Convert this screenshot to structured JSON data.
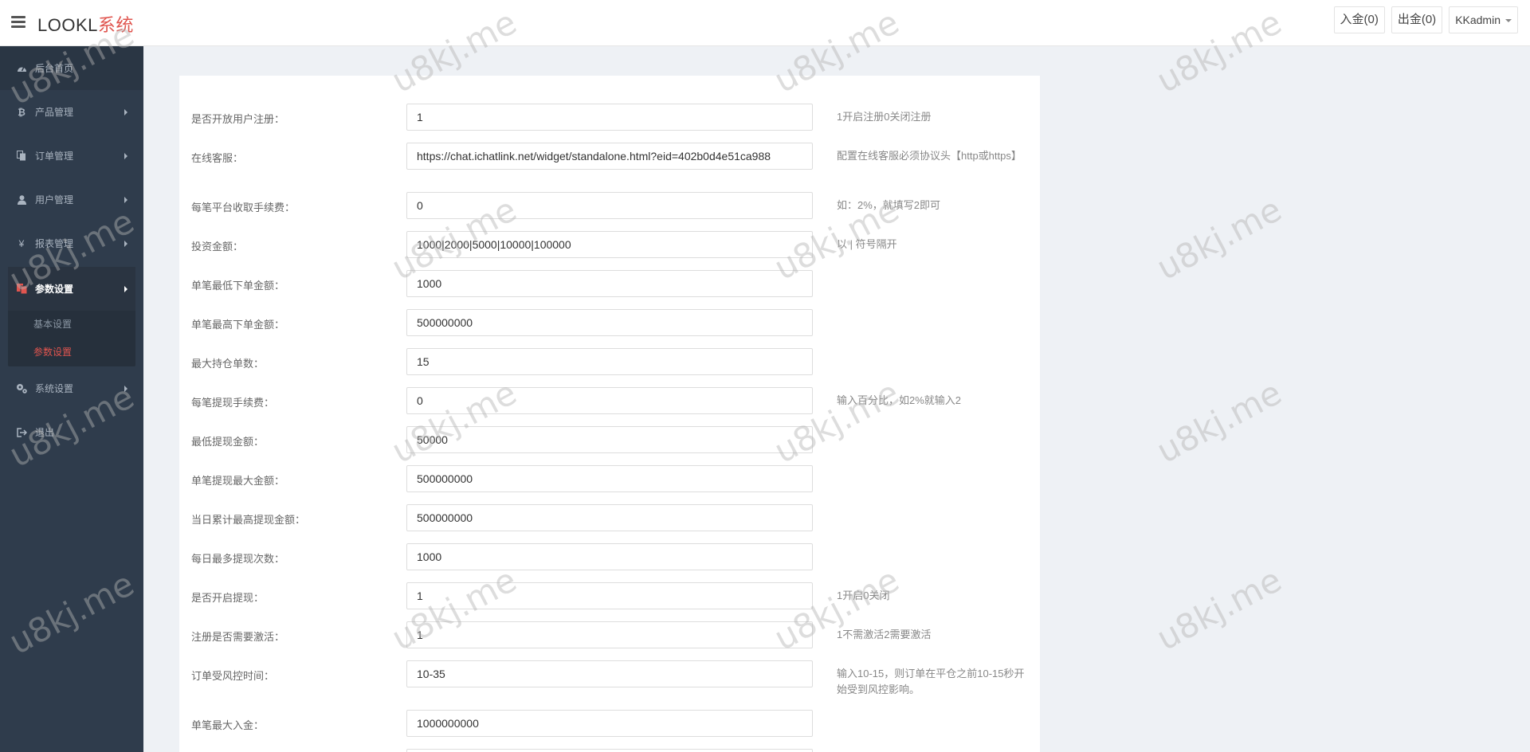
{
  "header": {
    "logo_main": "LOOKL",
    "logo_sys": "系统",
    "deposit": "入金(0)",
    "withdraw": "出金(0)",
    "user": "KKadmin"
  },
  "sidebar": {
    "items": [
      {
        "label": "后台首页",
        "icon": "dashboard-icon"
      },
      {
        "label": "产品管理",
        "icon": "bitcoin-icon"
      },
      {
        "label": "订单管理",
        "icon": "copy-icon"
      },
      {
        "label": "用户管理",
        "icon": "user-icon"
      },
      {
        "label": "报表管理",
        "icon": "yen-icon"
      },
      {
        "label": "参数设置",
        "icon": "files-icon"
      },
      {
        "label": "系统设置",
        "icon": "gears-icon"
      },
      {
        "label": "退出",
        "icon": "sign-out-icon"
      }
    ],
    "sub_items": [
      {
        "label": "基本设置"
      },
      {
        "label": "参数设置"
      }
    ]
  },
  "form": {
    "rows": [
      {
        "label": "是否开放用户注册：",
        "value": "1",
        "hint": "1开启注册0关闭注册"
      },
      {
        "label": "在线客服：",
        "value": "https://chat.ichatlink.net/widget/standalone.html?eid=402b0d4e51ca988",
        "hint": "配置在线客服必须协议头【http或https】"
      },
      {
        "label": "每笔平台收取手续费：",
        "value": "0",
        "hint": "如：2%，就填写2即可"
      },
      {
        "label": "投资金额：",
        "value": "1000|2000|5000|10000|100000",
        "hint": "以 | 符号隔开"
      },
      {
        "label": "单笔最低下单金额：",
        "value": "1000",
        "hint": ""
      },
      {
        "label": "单笔最高下单金额：",
        "value": "500000000",
        "hint": ""
      },
      {
        "label": "最大持仓单数：",
        "value": "15",
        "hint": ""
      },
      {
        "label": "每笔提现手续费：",
        "value": "0",
        "hint": "输入百分比，如2%就输入2"
      },
      {
        "label": "最低提现金额：",
        "value": "50000",
        "hint": ""
      },
      {
        "label": "单笔提现最大金额：",
        "value": "500000000",
        "hint": ""
      },
      {
        "label": "当日累计最高提现金额：",
        "value": "500000000",
        "hint": ""
      },
      {
        "label": "每日最多提现次数：",
        "value": "1000",
        "hint": ""
      },
      {
        "label": "是否开启提现：",
        "value": "1",
        "hint": "1开启0关闭"
      },
      {
        "label": "注册是否需要激活：",
        "value": "1",
        "hint": "1不需激活2需要激活"
      },
      {
        "label": "订单受风控时间：",
        "value": "10-35",
        "hint": "输入10-15，则订单在平仓之前10-15秒开始受到风控影响。"
      },
      {
        "label": "单笔最大入金：",
        "value": "1000000000",
        "hint": ""
      }
    ]
  },
  "watermark": "u8kj.me",
  "colors": {
    "accent": "#e0554f",
    "sidebar": "#2f3c4c"
  }
}
